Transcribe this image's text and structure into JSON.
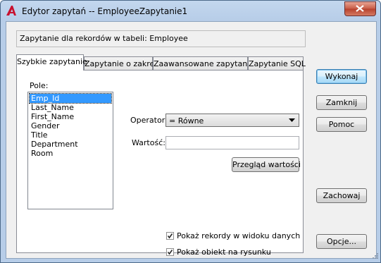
{
  "window": {
    "title": "Edytor zapytań -- EmployeeZapytanie1"
  },
  "info_text": "Zapytanie dla rekordów w tabeli:  Employee",
  "tabs": [
    {
      "label": "Szybkie zapytanie"
    },
    {
      "label": "Zapytanie o zakres"
    },
    {
      "label": "Zaawansowane zapytanie"
    },
    {
      "label": "Zapytanie SQL"
    }
  ],
  "fields": {
    "label": "Pole:",
    "items": [
      "Emp_Id",
      "Last_Name",
      "First_Name",
      "Gender",
      "Title",
      "Department",
      "Room"
    ],
    "selected": "Emp_Id"
  },
  "operator": {
    "label": "Operator:",
    "value": "=   Równe"
  },
  "value_field": {
    "label": "Wartość:",
    "value": ""
  },
  "browse_values_button": "Przegląd wartości",
  "checkboxes": [
    {
      "label": "Pokaż rekordy w widoku danych",
      "checked": true
    },
    {
      "label": "Pokaż obiekt na rysunku",
      "checked": true
    }
  ],
  "buttons": {
    "execute": "Wykonaj",
    "close": "Zamknij",
    "help": "Pomoc",
    "save": "Zachowaj",
    "options": "Opcje..."
  },
  "colors": {
    "app_icon": "#c8102e",
    "selection": "#3399ff",
    "close_button": "#c75b46"
  }
}
